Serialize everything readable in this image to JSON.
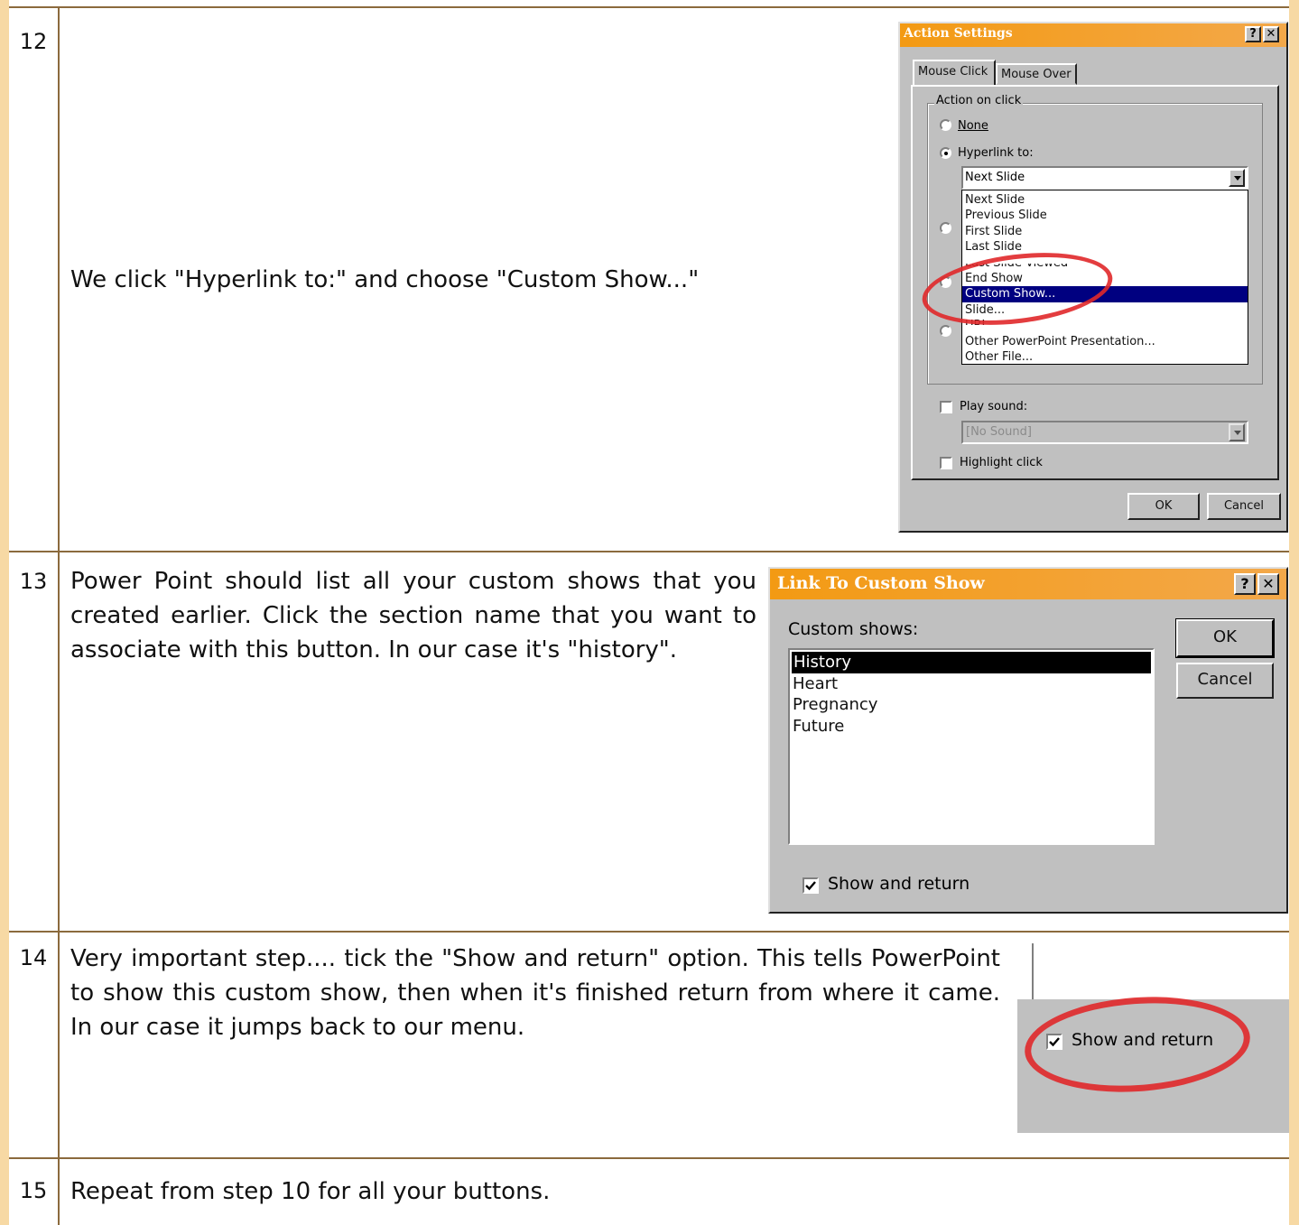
{
  "steps": [
    {
      "num": "12",
      "text": "We click \"Hyperlink to:\" and choose \"Custom Show...\""
    },
    {
      "num": "13",
      "text": "Power Point should list all your custom shows that you created earlier. Click the section name that you want to associate with this button. In our case it's \"history\"."
    },
    {
      "num": "14",
      "text": "Very important step.... tick the \"Show and return\" option. This tells PowerPoint to show this custom show, then when it's finished return from where it came. In our case it jumps back to our menu."
    },
    {
      "num": "15",
      "text": "Repeat from step 10 for all your buttons."
    }
  ],
  "action_dialog": {
    "title": "Action Settings",
    "help": "?",
    "close": "✕",
    "tabs": [
      "Mouse Click",
      "Mouse Over"
    ],
    "group_label": "Action on click",
    "none_label": "None",
    "hyperlink_label": "Hyperlink to:",
    "hyperlink_value": "Next Slide",
    "hyperlink_options": [
      "Next Slide",
      "Previous Slide",
      "First Slide",
      "Last Slide",
      "Last Slide Viewed",
      "End Show",
      "Custom Show...",
      "Slide...",
      "URL...",
      "Other PowerPoint Presentation...",
      "Other File..."
    ],
    "selected_option": "Custom Show...",
    "play_sound_label": "Play sound:",
    "sound_value": "[No Sound]",
    "highlight_label": "Highlight click",
    "ok": "OK",
    "cancel": "Cancel"
  },
  "custom_dialog": {
    "title": "Link To Custom Show",
    "help": "?",
    "close": "✕",
    "list_label": "Custom shows:",
    "shows": [
      "History",
      "Heart",
      "Pregnancy",
      "Future"
    ],
    "selected": "History",
    "show_return_label": "Show and return",
    "ok": "OK",
    "cancel": "Cancel"
  },
  "crop": {
    "show_return_label": "Show and return"
  },
  "colors": {
    "title_bar": "#f39a13",
    "selection": "#000080",
    "highlight_ring": "#e0282a",
    "table_border": "#8b6a3d",
    "side_band": "#f7d9a4"
  }
}
